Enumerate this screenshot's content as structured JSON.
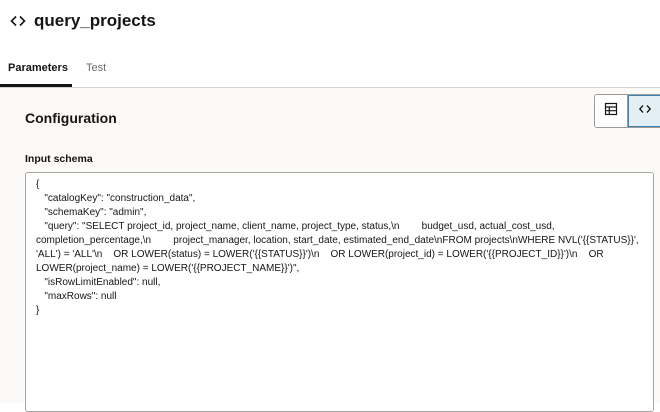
{
  "header": {
    "title": "query_projects",
    "icon": "code-brackets-icon"
  },
  "tabs": [
    {
      "label": "Parameters",
      "active": true
    },
    {
      "label": "Test",
      "active": false
    }
  ],
  "configuration": {
    "section_title": "Configuration",
    "view_toggle": {
      "options": [
        {
          "icon": "table-icon",
          "selected": false
        },
        {
          "icon": "code-brackets-icon",
          "selected": true
        }
      ]
    },
    "input_schema": {
      "label": "Input schema",
      "value": "{\n   \"catalogKey\": \"construction_data\",\n   \"schemaKey\": \"admin\",\n   \"query\": \"SELECT project_id, project_name, client_name, project_type, status,\\n        budget_usd, actual_cost_usd, completion_percentage,\\n        project_manager, location, start_date, estimated_end_date\\nFROM projects\\nWHERE NVL('{{STATUS}}', 'ALL') = 'ALL'\\n    OR LOWER(status) = LOWER('{{STATUS}}')\\n    OR LOWER(project_id) = LOWER('{{PROJECT_ID}}')\\n    OR LOWER(project_name) = LOWER('{{PROJECT_NAME}}')\",\n   \"isRowLimitEnabled\": null,\n   \"maxRows\": null\n}"
    }
  },
  "colors": {
    "text": "#161513",
    "muted_text": "#6f6c69",
    "content_background": "#fbfaf9",
    "toggle_selected_border": "#3b85b5",
    "toggle_selected_background": "#e4eef5"
  }
}
